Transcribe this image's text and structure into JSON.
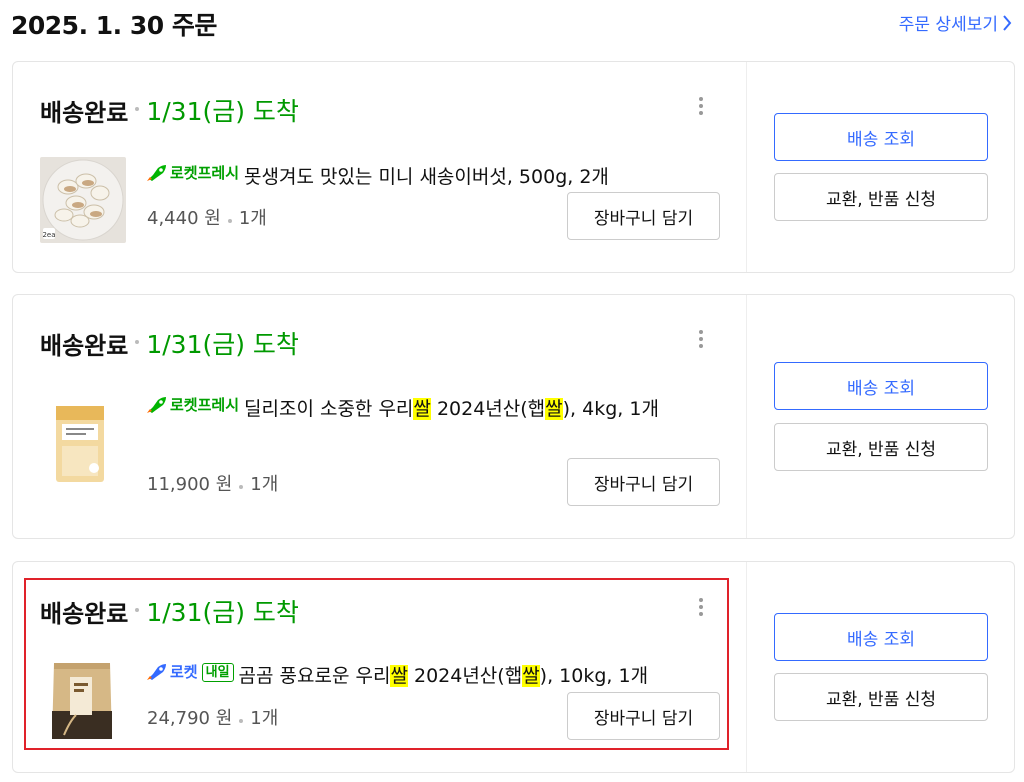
{
  "header": {
    "order_date": "2025. 1. 30 주문",
    "detail_link": "주문 상세보기"
  },
  "colors": {
    "accent": "#346aff",
    "arrival_green": "#009900",
    "highlight_red": "#e0222a",
    "keyword_highlight": "#ffff00"
  },
  "orders": [
    {
      "status": "배송완료",
      "arrival": "1/31(금) 도착",
      "badge_type": "rocket-fresh",
      "badge_label": "로켓프레시",
      "name_parts": [
        "못생겨도 맛있는 미니 새송이버섯, 500g, 2개"
      ],
      "price": "4,440 원",
      "qty": "1개",
      "thumb_label": "2ea",
      "cart_button": "장바구니 담기",
      "track_button": "배송 조회",
      "return_button": "교환, 반품 신청"
    },
    {
      "status": "배송완료",
      "arrival": "1/31(금) 도착",
      "badge_type": "rocket-fresh",
      "badge_label": "로켓프레시",
      "name_parts": [
        "딜리조이 소중한 우리",
        "쌀",
        " 2024년산(햅",
        "쌀",
        "), 4kg, 1개"
      ],
      "price": "11,900 원",
      "qty": "1개",
      "cart_button": "장바구니 담기",
      "track_button": "배송 조회",
      "return_button": "교환, 반품 신청"
    },
    {
      "status": "배송완료",
      "arrival": "1/31(금) 도착",
      "badge_type": "rocket-nextday",
      "badge_label": "로켓",
      "badge_sub": "내일",
      "name_parts": [
        "곰곰 풍요로운 우리",
        "쌀",
        " 2024년산(햅",
        "쌀",
        "), 10kg, 1개"
      ],
      "price": "24,790 원",
      "qty": "1개",
      "cart_button": "장바구니 담기",
      "track_button": "배송 조회",
      "return_button": "교환, 반품 신청"
    }
  ]
}
